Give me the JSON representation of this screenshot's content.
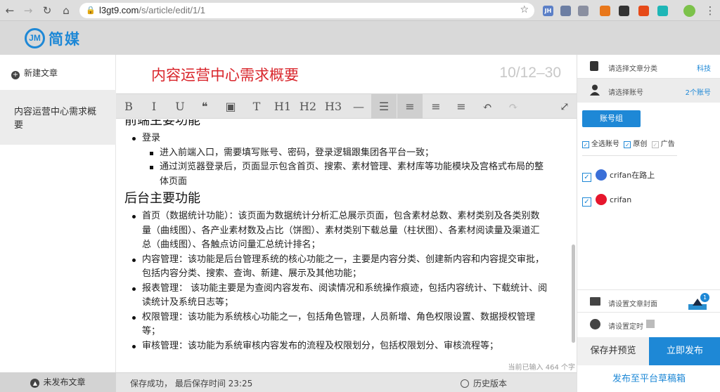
{
  "browser": {
    "url_host": "l3gt9.com",
    "url_path": "/s/article/edit/1/1",
    "extensions": [
      {
        "name": "jh-ext",
        "label": "JH",
        "color": "#5b7fc7"
      },
      {
        "name": "atom-ext",
        "label": "",
        "color": "#6c7ea3"
      },
      {
        "name": "react-ext",
        "label": "",
        "color": "#8a8fa0"
      },
      {
        "name": "orange-ext",
        "label": "",
        "color": "#e8771b"
      },
      {
        "name": "qr-ext",
        "label": "",
        "color": "#333333"
      },
      {
        "name": "red-ext",
        "label": "",
        "color": "#e64a19"
      },
      {
        "name": "teal-ext",
        "label": "",
        "color": "#1eb6b6"
      },
      {
        "name": "avatar-ext",
        "label": "",
        "color": "#7cc24a"
      }
    ]
  },
  "header": {
    "logo_mark": "JM",
    "logo_text": "简媒"
  },
  "sidebar": {
    "new_article": "新建文章",
    "article_title": "内容运营中心需求概要",
    "unpublished": "未发布文章"
  },
  "editor": {
    "title": "内容运营中心需求概要",
    "date": "10/12–30",
    "toolbar": [
      {
        "name": "bold-button",
        "glyph": "B"
      },
      {
        "name": "italic-button",
        "glyph": "I"
      },
      {
        "name": "underline-button",
        "glyph": "U"
      },
      {
        "name": "quote-button",
        "glyph": "❝"
      },
      {
        "name": "image-button",
        "glyph": "▣"
      },
      {
        "name": "text-button",
        "glyph": "T"
      },
      {
        "name": "h1-button",
        "glyph": "H1"
      },
      {
        "name": "h2-button",
        "glyph": "H2"
      },
      {
        "name": "h3-button",
        "glyph": "H3"
      },
      {
        "name": "hr-button",
        "glyph": "—"
      },
      {
        "name": "list-button",
        "glyph": "☰"
      },
      {
        "name": "align-left-button",
        "glyph": "≡"
      },
      {
        "name": "align-center-button",
        "glyph": "≡"
      },
      {
        "name": "align-right-button",
        "glyph": "≡"
      },
      {
        "name": "undo-button",
        "glyph": "↶"
      },
      {
        "name": "redo-button",
        "glyph": "↷"
      },
      {
        "name": "fullscreen-button",
        "glyph": "⤢"
      }
    ],
    "content": {
      "heading_frontend_partial": "前端主要功能",
      "login_item": "登录",
      "login_sub": [
        "进入前端入口，需要填写账号、密码，登录逻辑跟集团各平台一致；",
        "通过浏览器登录后，页面显示包含首页、搜索、素材管理、素材库等功能模块及宫格式布局的整体页面"
      ],
      "heading_backend": "后台主要功能",
      "backend_items": [
        "首页（数据统计功能）：该页面为数据统计分析汇总展示页面，包含素材总数、素材类别及各类别数量（曲线图）、各产业素材数及占比（饼图）、素材类别下载总量（柱状图）、各素材阅读量及渠道汇总（曲线图）、各触点访问量汇总统计排名；",
        "内容管理：该功能是后台管理系统的核心功能之一，主要是内容分类、创建新内容和内容提交审批，包括内容分类、搜索、查询、新建、展示及其他功能；",
        "报表管理：  该功能主要是为查阅内容发布、阅读情况和系统操作痕迹，包括内容统计、下载统计、阅读统计及系统日志等；",
        "权限管理：该功能为系统核心功能之一，包括角色管理，人员新增、角色权限设置、数据授权管理等；",
        "审核管理：该功能为系统审核内容发布的流程及权限划分，包括权限划分、审核流程等；"
      ]
    },
    "word_count": "当前已输入 464 个字",
    "save_status": "保存成功，  最后保存时间 23:25",
    "history": "历史版本"
  },
  "panel": {
    "category_label": "请选择文章分类",
    "category_value": "科技",
    "account_label": "请选择账号",
    "account_value": "2个账号",
    "group_button": "账号组",
    "select_all": "全选账号",
    "original": "原创",
    "ad": "广告",
    "accounts": [
      {
        "name": "crifan在路上",
        "color": "#3a6fd8"
      },
      {
        "name": "crifan",
        "color": "#e6162d"
      }
    ],
    "cover_label": "请设置文章封面",
    "cover_badge": "1",
    "timer_label": "请设置定时",
    "preview_button": "保存并预览",
    "publish_button": "立即发布",
    "draft_link": "发布至平台草稿箱"
  }
}
